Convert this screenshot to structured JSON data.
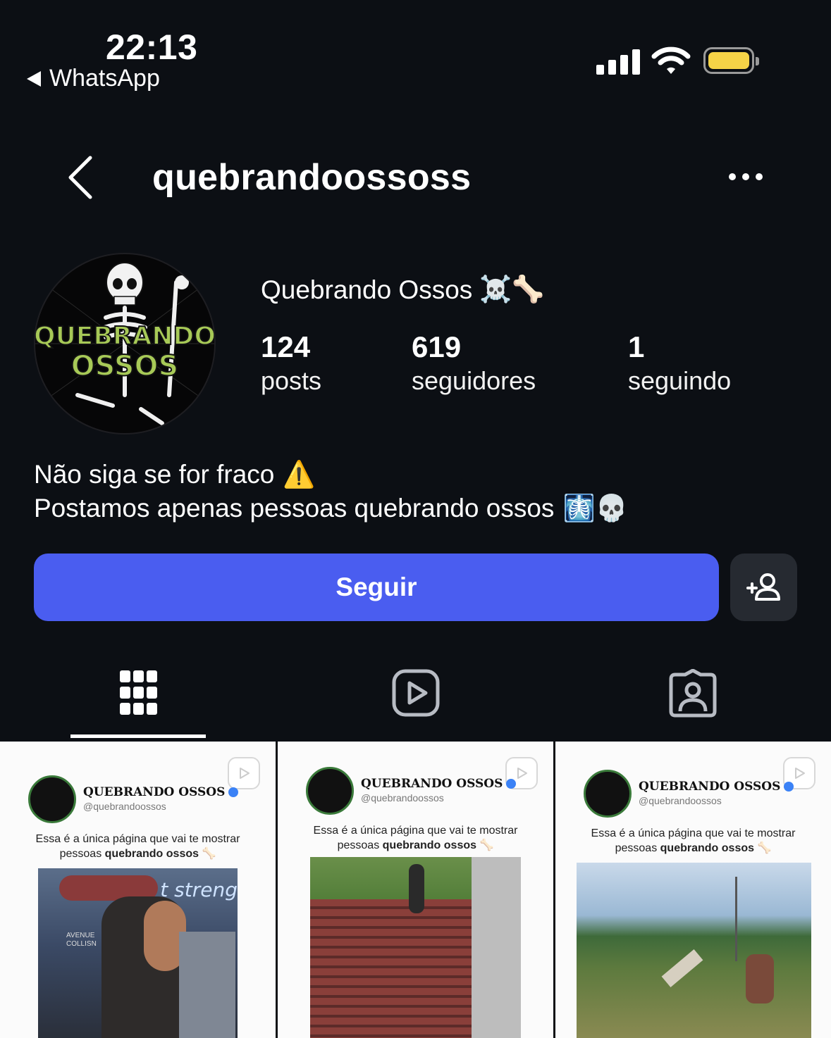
{
  "status_bar": {
    "time": "22:13",
    "back_app": "WhatsApp",
    "icons": [
      "signal-icon",
      "wifi-icon",
      "battery-icon"
    ],
    "battery_color": "#f5d347"
  },
  "header": {
    "username": "quebrandoossoss",
    "icons": [
      "back-chevron-icon",
      "more-options-icon"
    ]
  },
  "profile": {
    "display_name": "Quebrando Ossos",
    "name_emojis": "☠️🦴",
    "avatar_text": [
      "QUEBRANDO",
      "OSSOS"
    ],
    "stats": [
      {
        "value": "124",
        "label": "posts"
      },
      {
        "value": "619",
        "label": "seguidores"
      },
      {
        "value": "1",
        "label": "seguindo"
      }
    ],
    "bio": [
      {
        "text": "Não siga se for fraco",
        "emoji": "⚠️"
      },
      {
        "text": "Postamos apenas pessoas quebrando ossos",
        "emoji": "🩻💀"
      }
    ]
  },
  "actions": {
    "follow_label": "Seguir",
    "follow_color": "#4a5df0",
    "suggest_icon": "add-person-icon"
  },
  "tabs": [
    {
      "icon": "grid-icon",
      "active": true
    },
    {
      "icon": "reels-icon",
      "active": false
    },
    {
      "icon": "tagged-icon",
      "active": false
    }
  ],
  "grid": [
    {
      "name": "QUEBRANDO OSSOS",
      "handle": "@quebrandoossos",
      "caption_line1": "Essa é a única página que vai te mostrar",
      "caption_line2_normal": "pessoas ",
      "caption_line2_bold": "quebrando ossos",
      "caption_emoji": "🦴",
      "photo_text": "t streng",
      "photo_text2": "AVENUE\nCOLLISN"
    },
    {
      "name": "QUEBRANDO OSSOS",
      "handle": "@quebrandoossos",
      "caption_line1": "Essa é a única página que vai te mostrar",
      "caption_line2_normal": "pessoas ",
      "caption_line2_bold": "quebrando ossos",
      "caption_emoji": "🦴"
    },
    {
      "name": "QUEBRANDO OSSOS",
      "handle": "@quebrandoossos",
      "caption_line1": "Essa é a única página que vai te mostrar",
      "caption_line2_normal": "pessoas ",
      "caption_line2_bold": "quebrando ossos",
      "caption_emoji": "🦴"
    }
  ]
}
